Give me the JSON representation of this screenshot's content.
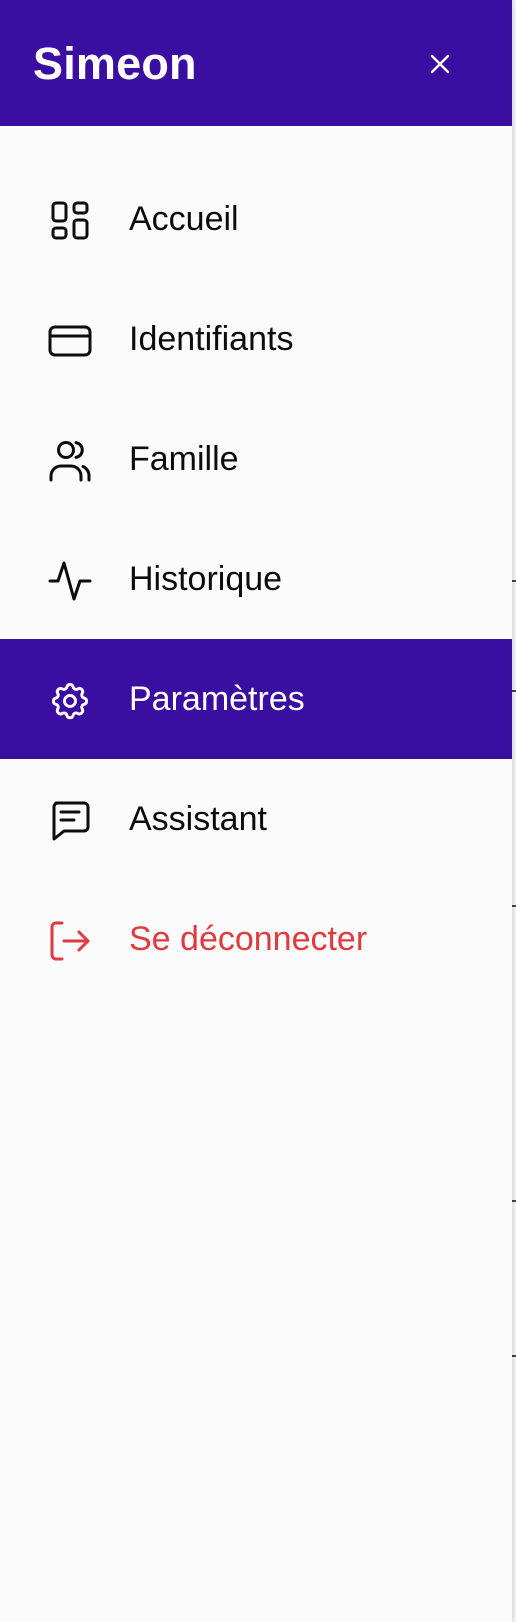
{
  "app": {
    "brand": "Simeon"
  },
  "colors": {
    "header_bg": "#3a0ea0",
    "active_bg": "#3a0ea0",
    "danger": "#e0393e",
    "text": "#0c0c0c",
    "drawer_bg": "#fbfbfb"
  },
  "header": {
    "close_icon": "close-icon"
  },
  "nav": {
    "active": "Paramètres",
    "items": [
      {
        "label": "Accueil",
        "icon": "dashboard-icon"
      },
      {
        "label": "Identifiants",
        "icon": "credit-card-icon"
      },
      {
        "label": "Famille",
        "icon": "users-icon"
      },
      {
        "label": "Historique",
        "icon": "activity-icon"
      },
      {
        "label": "Paramètres",
        "icon": "gear-icon"
      },
      {
        "label": "Assistant",
        "icon": "chat-icon"
      },
      {
        "label": "Se déconnecter",
        "icon": "logout-icon"
      }
    ]
  }
}
